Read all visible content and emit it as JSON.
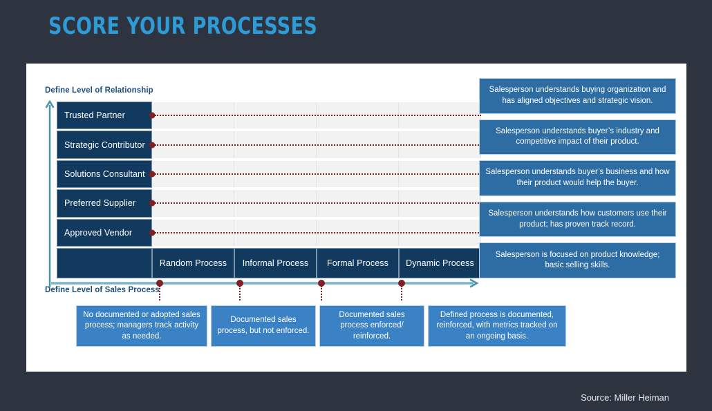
{
  "slide": {
    "title": "SCORE YOUR PROCESSES",
    "source": "Source: Miller Heiman"
  },
  "axes": {
    "y_caption": "Define Level of Relationship",
    "x_caption": "Define Level of Sales Process"
  },
  "colors": {
    "background": "#2d333f",
    "panel": "#ffffff",
    "title": "#2f9bd6",
    "dark_navy": "#123a5e",
    "callout_blue": "#2e6da4",
    "bottom_callout_blue": "#3b82c4",
    "connector_red": "#7e2024",
    "axis_teal": "#4a94aa",
    "caption_blue": "#1d4e7e"
  },
  "chart_data": {
    "type": "table",
    "title": "SCORE YOUR PROCESSES",
    "xlabel": "Define Level of Sales Process",
    "ylabel": "Define Level of Relationship",
    "categories": [
      "Random Process",
      "Informal Process",
      "Formal Process",
      "Dynamic Process"
    ],
    "levels": [
      "Trusted Partner",
      "Strategic Contributor",
      "Solutions Consultant",
      "Preferred Supplier",
      "Approved Vendor"
    ],
    "level_descriptions": [
      "Salesperson understands buying organization and has aligned objectives and strategic vision.",
      "Salesperson understands buyer’s industry and competitive impact of their product.",
      "Salesperson understands buyer’s business and how their product would help the buyer.",
      "Salesperson understands how customers use their product; has proven track record.",
      "Salesperson is focused on product knowledge; basic selling skills."
    ],
    "process_descriptions": [
      "No documented or adopted sales process; managers track activity as needed.",
      "Documented sales process, but not enforced.",
      "Documented sales process enforced/ reinforced.",
      "Defined process is documented, reinforced, with metrics tracked on an ongoing basis."
    ],
    "grid": true,
    "legend": "none"
  },
  "matrix": {
    "rows": [
      {
        "label": "Trusted Partner"
      },
      {
        "label": "Strategic Contributor"
      },
      {
        "label": "Solutions Consultant"
      },
      {
        "label": "Preferred Supplier"
      },
      {
        "label": "Approved Vendor"
      }
    ],
    "columns": [
      {
        "label": "Random Process"
      },
      {
        "label": "Informal Process"
      },
      {
        "label": "Formal Process"
      },
      {
        "label": "Dynamic Process"
      }
    ]
  },
  "right_callouts": [
    {
      "text": "Salesperson understands buying organization and has aligned objectives and strategic vision."
    },
    {
      "text": "Salesperson understands buyer’s industry and competitive impact of their product."
    },
    {
      "text": "Salesperson understands buyer’s business and how their product would help the buyer."
    },
    {
      "text": "Salesperson understands how customers use their product; has proven track record."
    },
    {
      "text": "Salesperson is focused on product knowledge; basic selling skills."
    }
  ],
  "bottom_callouts": [
    {
      "text": "No documented or adopted sales process; managers track activity as needed."
    },
    {
      "text": "Documented sales process, but not enforced."
    },
    {
      "text": "Documented sales process enforced/ reinforced."
    },
    {
      "text": "Defined process is documented, reinforced, with metrics tracked on an ongoing basis."
    }
  ]
}
